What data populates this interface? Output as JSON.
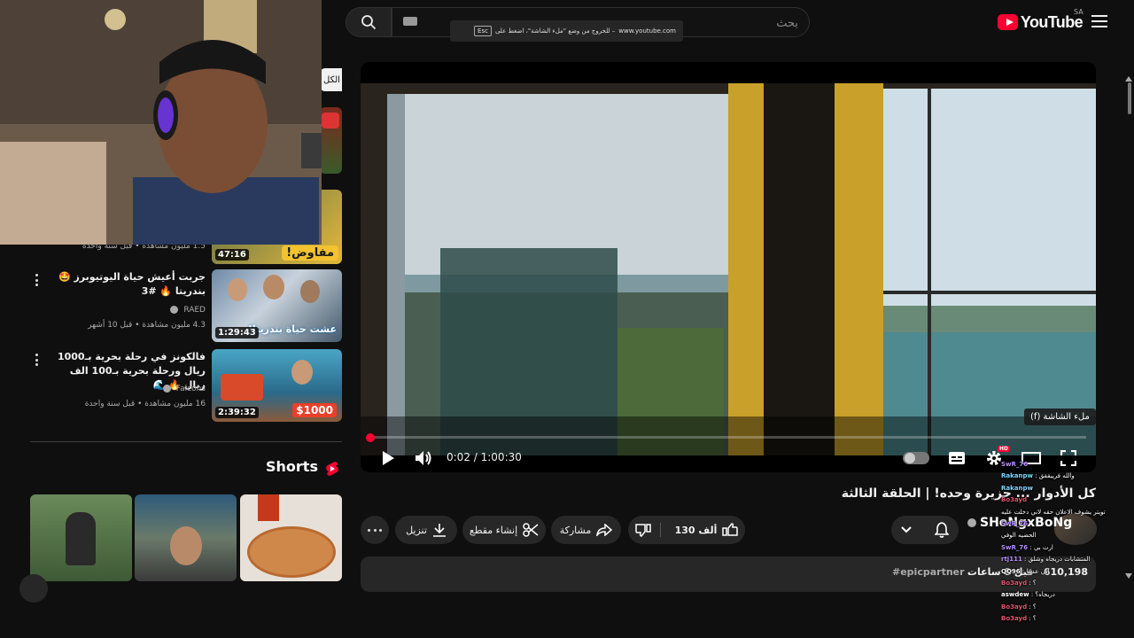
{
  "header": {
    "logo_text": "YouTube",
    "country_code": "SA",
    "search_placeholder": "بحث"
  },
  "fullscreen_toast": {
    "domain": "www.youtube.com",
    "message": "– للخروج من وضع \"ملء الشاشة\"، اضغط على",
    "key": "Esc"
  },
  "sidebar": {
    "chip_label": "الكل",
    "videos": [
      {
        "title": "",
        "channel": "",
        "views": "1.5 مليون مشاهدة",
        "age": "قبل سنة واحدة",
        "duration": "47:16",
        "thumb_text": "مفاوض!"
      },
      {
        "title": "جربت أعيش حياة اليوتيوبرز 🤩 بندريتا 🔥 #3",
        "channel": "RAED",
        "views": "4.3 مليون مشاهدة",
        "age": "قبل 10 أشهر",
        "duration": "1:29:43",
        "thumb_text": "عشت حياة بندريتا!"
      },
      {
        "title": "فالكونز في رحلة بحرية بـ1000 ريال ورحلة بحرية بـ100 الف ريال 🔥 🌊",
        "channel": "Falcons",
        "views": "16 مليون مشاهدة",
        "age": "قبل سنة واحدة",
        "duration": "2:39:32",
        "thumb_text": "$1000"
      }
    ],
    "shorts_heading": "Shorts"
  },
  "player": {
    "time": "0:02 / 1:00:30",
    "progress_fraction": 0.001,
    "tooltip": "ملء الشاشة (f)",
    "hd_badge": "HD"
  },
  "video": {
    "title": "كل الأدوار ... جزيرة وحده! | الحلقة الثالثة",
    "channel": "SHoNgxBoNg",
    "likes": "130 ألف",
    "buttons": {
      "share": "مشاركة",
      "clip": "إنشاء مقطع",
      "download": "تنزيل"
    },
    "views": "610,198",
    "age": "قبل 8 ساعات",
    "hashtag": "#epicpartner"
  },
  "chat": [
    {
      "user": "SwR_76",
      "msg": "",
      "color": "#b68cff"
    },
    {
      "user": "Rakanpw",
      "msg": "والله فرييققق",
      "color": "#7fd4ff"
    },
    {
      "user": "Rakanpw",
      "msg": "",
      "color": "#7fd4ff"
    },
    {
      "user": "",
      "msg": "",
      "color": "#ffffff"
    },
    {
      "user": "Bo3ayd",
      "msg": "",
      "color": "#e0556f"
    },
    {
      "user": "",
      "msg": "تويتر يشوف الاعلان حقه لاني دخلت عليه",
      "color": "#ffffff"
    },
    {
      "user": "SwR_76",
      "msg": "",
      "color": "#b68cff"
    },
    {
      "user": "",
      "msg": "الحضيه الوفي",
      "color": "#ffffff"
    },
    {
      "user": "SwR_76",
      "msg": "ارت بي",
      "color": "#b68cff"
    },
    {
      "user": "rtj111",
      "msg": "المتشابات دريجاه وشلق",
      "color": "#b68cff"
    },
    {
      "user": "",
      "msg": "",
      "color": "#ffffff"
    },
    {
      "user": "QQ96",
      "msg": "اني عدتنا",
      "color": "#ffffff"
    },
    {
      "user": "Bo3ayd",
      "msg": "؟",
      "color": "#e0556f"
    },
    {
      "user": "aswdew",
      "msg": "دريجاه؟",
      "color": "#ffffff"
    },
    {
      "user": "Bo3ayd",
      "msg": "؟",
      "color": "#e0556f"
    },
    {
      "user": "Bo3ayd",
      "msg": "؟",
      "color": "#e0556f"
    }
  ],
  "colors": {
    "accent": "#ff0033",
    "background": "#0f0f0f",
    "pill": "#272727"
  }
}
